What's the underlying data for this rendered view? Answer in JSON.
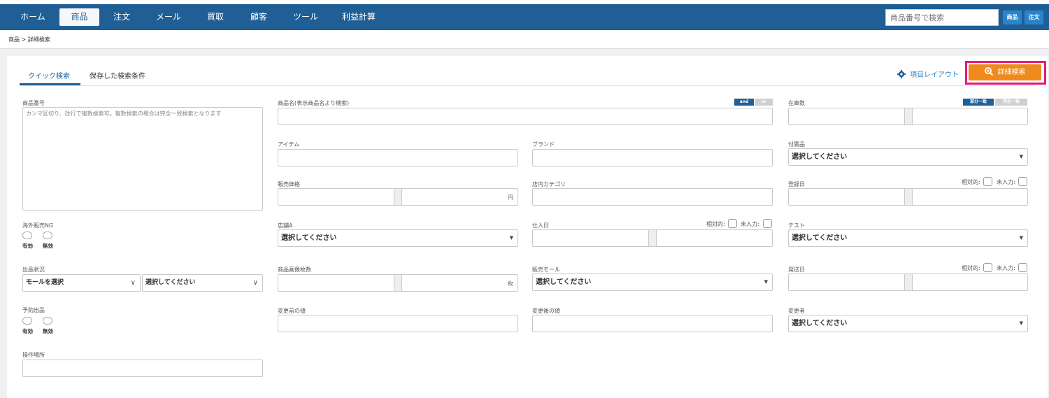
{
  "nav": {
    "items": [
      {
        "label": "ホーム",
        "active": false
      },
      {
        "label": "商品",
        "active": true
      },
      {
        "label": "注文",
        "active": false
      },
      {
        "label": "メール",
        "active": false
      },
      {
        "label": "買取",
        "active": false
      },
      {
        "label": "顧客",
        "active": false
      },
      {
        "label": "ツール",
        "active": false
      },
      {
        "label": "利益計算",
        "active": false
      }
    ],
    "search_placeholder": "商品番号で検索",
    "btn_product": "商品",
    "btn_order": "注文"
  },
  "breadcrumb": "商品 > 詳細検索",
  "tabs": {
    "quick": "クイック検索",
    "saved": "保存した検索条件"
  },
  "layout_link": "項目レイアウト",
  "advanced_search_button": "詳細検索",
  "form": {
    "product_no": {
      "label": "商品番号",
      "placeholder": "カンマ区切り、改行で複数検索可。複数検索の場合は完全一致検索となります"
    },
    "product_name": {
      "label": "商品名(表示商品名より検索)",
      "and": "and",
      "or": "or"
    },
    "stock": {
      "label": "在庫数",
      "partial": "部分一致",
      "exact": "完全一致"
    },
    "item": {
      "label": "アイテム"
    },
    "brand": {
      "label": "ブランド"
    },
    "accessory": {
      "label": "付属品",
      "value": "選択してください"
    },
    "price": {
      "label": "販売価格",
      "unit": "円"
    },
    "category": {
      "label": "店内カテゴリ"
    },
    "reg_date": {
      "label": "登録日",
      "relative": "相対的:",
      "empty": "未入力:"
    },
    "overseas_ng": {
      "label": "海外販売NG",
      "on": "有効",
      "off": "無効"
    },
    "shop_a": {
      "label": "店舗A",
      "value": "選択してください"
    },
    "purchase_date": {
      "label": "仕入日",
      "relative": "相対的:",
      "empty": "未入力:"
    },
    "test": {
      "label": "テスト",
      "value": "選択してください"
    },
    "listing_status": {
      "label": "出品状況",
      "mall": "モールを選択",
      "value": "選択してください"
    },
    "image_count": {
      "label": "商品画像枚数",
      "unit": "枚"
    },
    "sales_mall": {
      "label": "販売モール",
      "value": "選択してください"
    },
    "ship_date": {
      "label": "発送日",
      "relative": "相対的:",
      "empty": "未入力:"
    },
    "reserve_listing": {
      "label": "予約出品",
      "on": "有効",
      "off": "無効"
    },
    "before_value": {
      "label": "変更前の値"
    },
    "after_value": {
      "label": "変更後の値"
    },
    "changer": {
      "label": "変更者",
      "value": "選択してください"
    },
    "location": {
      "label": "操作場所"
    }
  },
  "colors": {
    "nav": "#1f5f95",
    "accent_orange": "#f08a1c",
    "highlight_pink": "#e6197d",
    "link_blue": "#2b84c9"
  }
}
